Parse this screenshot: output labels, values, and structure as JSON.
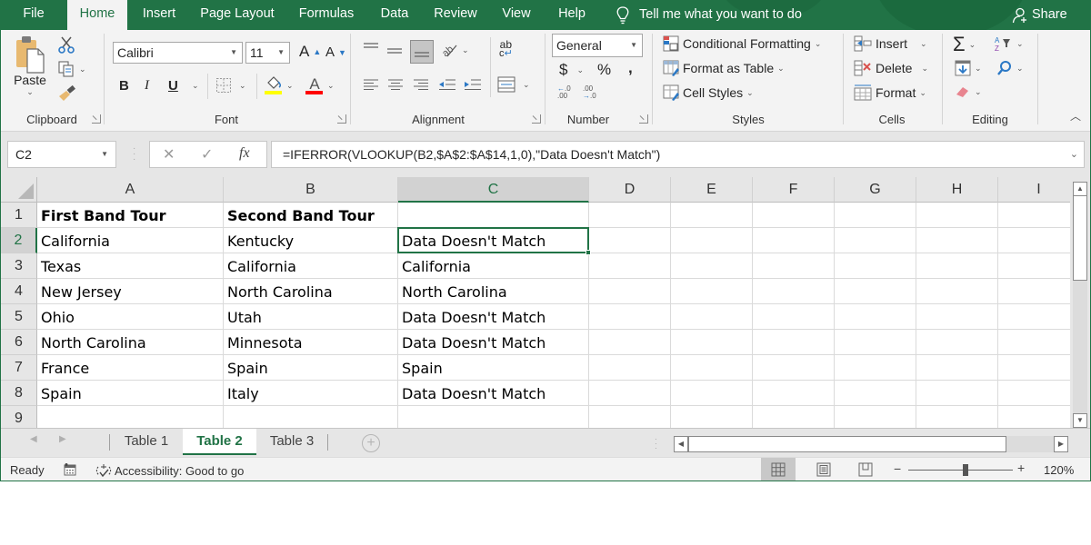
{
  "ribbon_tabs": [
    {
      "label": "File",
      "active": false
    },
    {
      "label": "Home",
      "active": true
    },
    {
      "label": "Insert",
      "active": false
    },
    {
      "label": "Page Layout",
      "active": false
    },
    {
      "label": "Formulas",
      "active": false
    },
    {
      "label": "Data",
      "active": false
    },
    {
      "label": "Review",
      "active": false
    },
    {
      "label": "View",
      "active": false
    },
    {
      "label": "Help",
      "active": false
    }
  ],
  "tell_me": {
    "icon": "lightbulb-icon",
    "label": "Tell me what you want to do"
  },
  "share": {
    "icon": "person-add-icon",
    "label": "Share"
  },
  "ribbon": {
    "clipboard": {
      "label": "Clipboard",
      "paste_label": "Paste",
      "cut_icon": "scissors-icon",
      "copy_icon": "copy-icon",
      "format_painter_icon": "paintbrush-icon"
    },
    "font": {
      "label": "Font",
      "font_name": "Calibri",
      "font_size": "11",
      "grow_label": "A",
      "shrink_label": "A",
      "bold_label": "B",
      "italic_label": "I",
      "underline_label": "U",
      "font_color_label": "A",
      "fill_color": "#ffff00",
      "font_color": "#ff0000"
    },
    "alignment": {
      "label": "Alignment",
      "wrap_label": "ab"
    },
    "number": {
      "label": "Number",
      "format": "General",
      "currency_label": "$",
      "percent_label": "%",
      "comma_label": ",",
      "inc_decimal_label": "←.0 .00",
      "dec_decimal_label": ".00 →.0"
    },
    "styles": {
      "label": "Styles",
      "items": [
        "Conditional Formatting",
        "Format as Table",
        "Cell Styles"
      ]
    },
    "cells": {
      "label": "Cells",
      "items": [
        "Insert",
        "Delete",
        "Format"
      ]
    },
    "editing": {
      "label": "Editing",
      "autosum_label": "Σ"
    }
  },
  "formula_bar": {
    "name_box": "C2",
    "cancel_label": "✕",
    "enter_label": "✓",
    "fx_label": "fx",
    "formula": "=IFERROR(VLOOKUP(B2,$A$2:$A$14,1,0),\"Data Doesn't Match\")"
  },
  "grid": {
    "columns": [
      "A",
      "B",
      "C",
      "D",
      "E",
      "F",
      "G",
      "H",
      "I"
    ],
    "selected_column": "C",
    "rows": [
      "1",
      "2",
      "3",
      "4",
      "5",
      "6",
      "7",
      "8",
      "9"
    ],
    "selected_row": "2",
    "selected_cell": "C2",
    "cells": [
      [
        "First Band Tour",
        "Second Band Tour",
        ""
      ],
      [
        "California",
        "Kentucky",
        "Data Doesn't Match"
      ],
      [
        "Texas",
        "California",
        "California"
      ],
      [
        "New Jersey",
        "North Carolina",
        "North Carolina"
      ],
      [
        "Ohio",
        "Utah",
        "Data Doesn't Match"
      ],
      [
        "North Carolina",
        "Minnesota",
        "Data Doesn't Match"
      ],
      [
        "France",
        "Spain",
        "Spain"
      ],
      [
        "Spain",
        "Italy",
        "Data Doesn't Match"
      ],
      [
        "",
        "",
        ""
      ]
    ]
  },
  "sheet_tabs": [
    {
      "label": "Table 1",
      "active": false
    },
    {
      "label": "Table 2",
      "active": true
    },
    {
      "label": "Table 3",
      "active": false
    }
  ],
  "add_sheet_label": "+",
  "status_bar": {
    "ready": "Ready",
    "accessibility": "Accessibility: Good to go",
    "zoom_minus": "−",
    "zoom_plus": "+",
    "zoom_level": "120%",
    "zoom_slider_fraction": 0.55
  },
  "colors": {
    "accent": "#217346"
  }
}
